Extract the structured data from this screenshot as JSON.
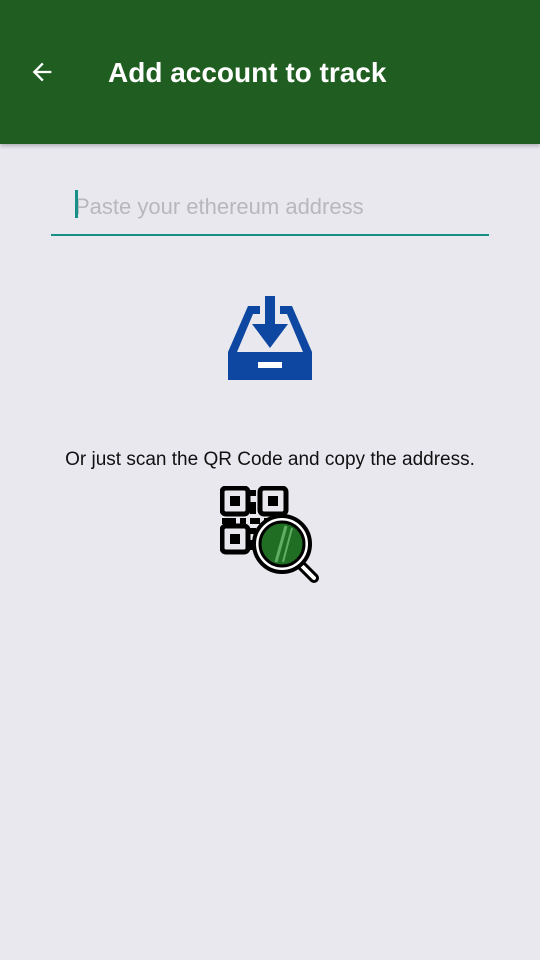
{
  "header": {
    "title": "Add account to track",
    "back_icon": "arrow-left-icon",
    "background_color": "#1f5e20"
  },
  "address_input": {
    "placeholder": "Paste your ethereum address",
    "value": "",
    "accent_color": "#15918a"
  },
  "paste_button": {
    "icon": "inbox-download-icon",
    "color": "#0d47a1"
  },
  "qr": {
    "hint_text": "Or just scan the QR Code and copy the address.",
    "icon": "qr-scan-icon",
    "lens_color": "#1f6e24"
  }
}
